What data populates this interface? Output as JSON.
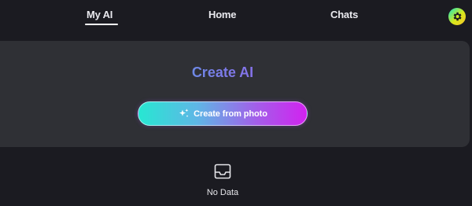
{
  "nav": {
    "tabs": [
      {
        "label": "My AI",
        "active": true
      },
      {
        "label": "Home",
        "active": false
      },
      {
        "label": "Chats",
        "active": false
      }
    ],
    "settings_icon": "gear-icon"
  },
  "create": {
    "title": "Create AI",
    "button_label": "Create from photo",
    "button_icon": "sparkle-icon"
  },
  "empty_state": {
    "icon": "inbox-icon",
    "text": "No Data"
  },
  "colors": {
    "background": "#1b1b21",
    "panel": "#2f3035",
    "accent_start": "#27e7d2",
    "accent_end": "#d222f0"
  }
}
